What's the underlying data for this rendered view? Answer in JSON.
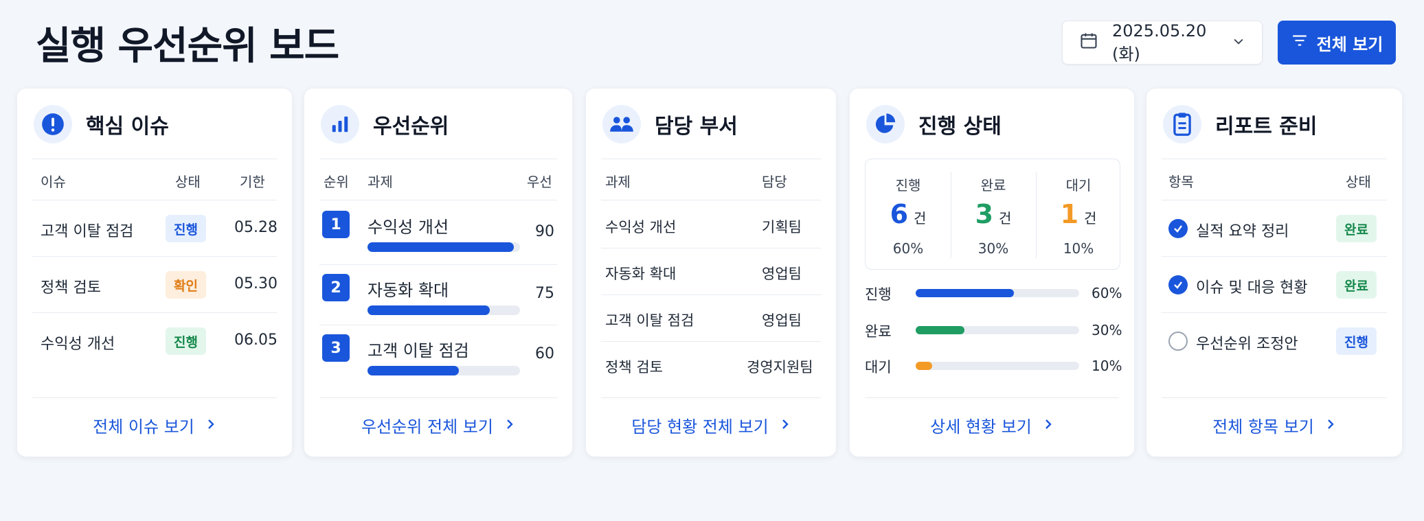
{
  "header": {
    "title": "실행 우선순위 보드",
    "date": "2025.05.20 (화)",
    "view_all": "전체 보기"
  },
  "colors": {
    "accent": "#1a56db",
    "green": "#1f9d63",
    "orange": "#f39a26"
  },
  "issues": {
    "title": "핵심 이슈",
    "icon": "exclamation-circle-icon",
    "columns": [
      "이슈",
      "상태",
      "기한"
    ],
    "rows": [
      {
        "name": "고객 이탈 점검",
        "status": "진행",
        "due": "05.28"
      },
      {
        "name": "정책 검토",
        "status": "확인",
        "due": "05.30"
      },
      {
        "name": "수익성 개선",
        "status": "진행",
        "due": "06.05"
      }
    ],
    "footer": "전체 이슈 보기"
  },
  "priority": {
    "title": "우선순위",
    "icon": "bar-chart-icon",
    "columns": [
      "순위",
      "과제",
      "우선"
    ],
    "rows": [
      {
        "rank": "1",
        "name": "수익성 개선",
        "score": "90",
        "level": 0.96
      },
      {
        "rank": "2",
        "name": "자동화 확대",
        "score": "75",
        "level": 0.8
      },
      {
        "rank": "3",
        "name": "고객 이탈 점검",
        "score": "60",
        "level": 0.6
      }
    ],
    "footer": "우선순위 전체 보기"
  },
  "departments": {
    "title": "담당 부서",
    "icon": "users-icon",
    "columns": [
      "과제",
      "담당"
    ],
    "rows": [
      {
        "task": "수익성 개선",
        "owner": "기획팀"
      },
      {
        "task": "자동화 확대",
        "owner": "영업팀"
      },
      {
        "task": "고객 이탈 점검",
        "owner": "영업팀"
      },
      {
        "task": "정책 검토",
        "owner": "경영지원팀"
      }
    ],
    "footer": "담당 현황 전체 보기"
  },
  "progress": {
    "title": "진행 상태",
    "icon": "pie-chart-icon",
    "unit": "건",
    "stats": [
      {
        "label": "진행",
        "count": "6",
        "pct": "60%"
      },
      {
        "label": "완료",
        "count": "3",
        "pct": "30%"
      },
      {
        "label": "대기",
        "count": "1",
        "pct": "10%"
      }
    ],
    "bars": [
      {
        "label": "진행",
        "pct": "60%",
        "fraction": 0.6
      },
      {
        "label": "완료",
        "pct": "30%",
        "fraction": 0.3
      },
      {
        "label": "대기",
        "pct": "10%",
        "fraction": 0.1
      }
    ],
    "footer": "상세 현황 보기"
  },
  "report": {
    "title": "리포트 준비",
    "icon": "clipboard-icon",
    "columns": [
      "항목",
      "상태"
    ],
    "rows": [
      {
        "item": "실적 요약 정리",
        "status": "완료",
        "checked": true
      },
      {
        "item": "이슈 및 대응 현황",
        "status": "완료",
        "checked": true
      },
      {
        "item": "우선순위 조정안",
        "status": "진행",
        "checked": false
      }
    ],
    "footer": "전체 항목 보기"
  }
}
